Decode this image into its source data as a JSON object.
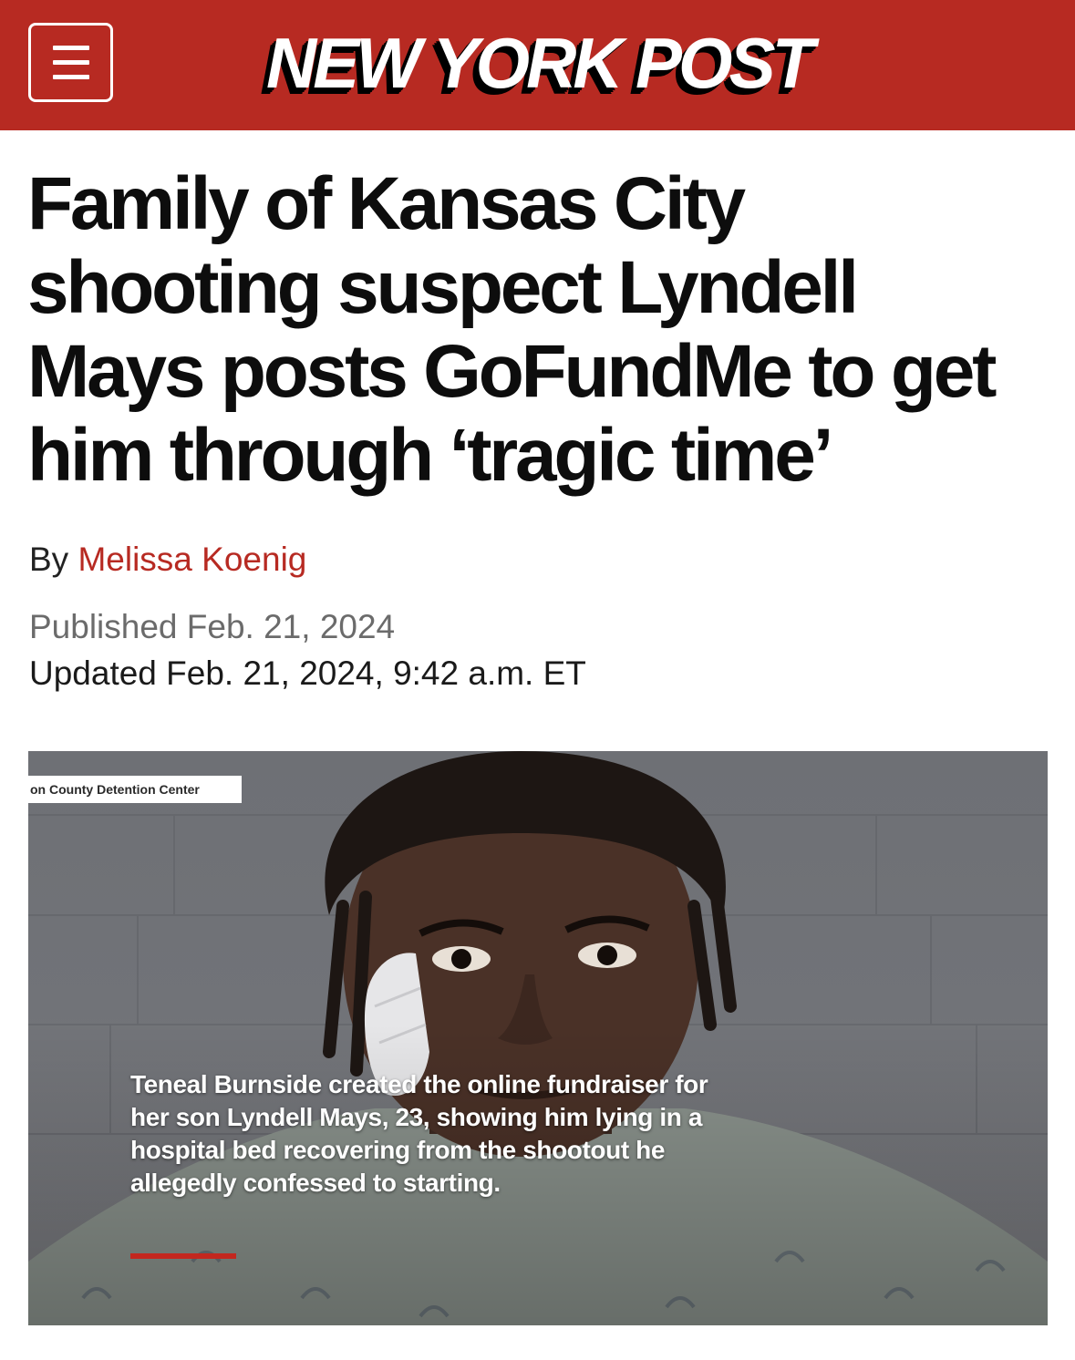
{
  "header": {
    "logo": "NEW YORK POST",
    "brand_color": "#b72a22",
    "menu_icon": "hamburger-menu-icon"
  },
  "article": {
    "headline": "Family of Kansas City shooting suspect Lyndell Mays posts GoFundMe to get him through ‘tragic time’",
    "byline_prefix": "By",
    "author": "Melissa Koenig",
    "published": "Published Feb. 21, 2024",
    "updated": "Updated Feb. 21, 2024, 9:42 a.m. ET"
  },
  "image": {
    "credit": "on County Detention Center",
    "caption": "Teneal Burnside created the online fundraiser for her son Lyndell Mays, 23, showing him lying in a hospital bed recovering from the shootout he allegedly confessed to starting."
  }
}
